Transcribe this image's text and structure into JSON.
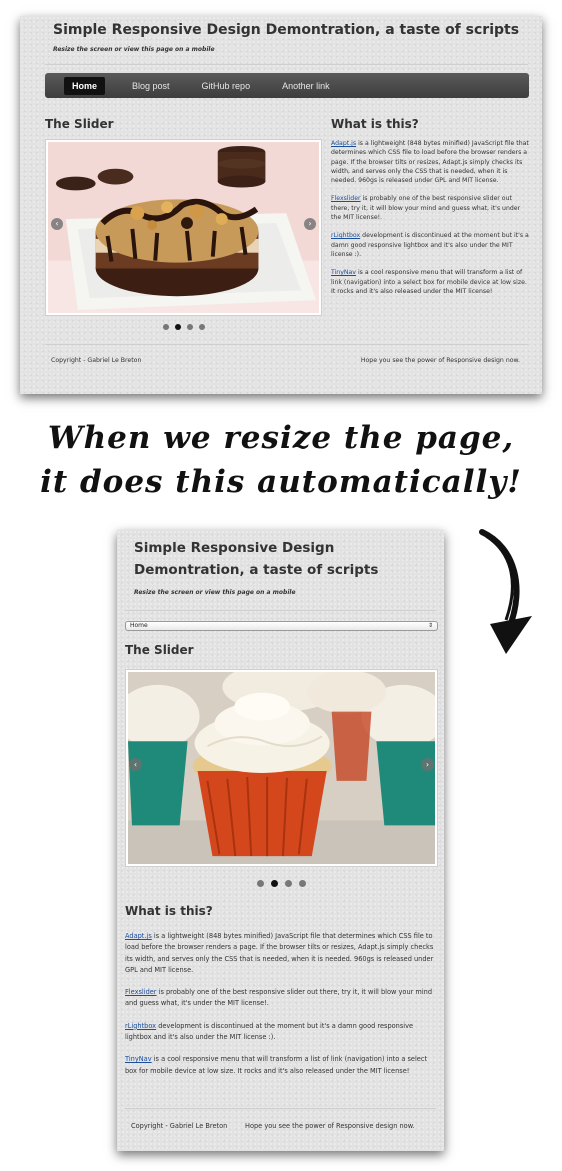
{
  "site": {
    "title": "Simple Responsive Design Demontration, a taste of scripts",
    "subtitle": "Resize the screen or view this page on a mobile"
  },
  "nav": {
    "items": [
      {
        "label": "Home",
        "active": true
      },
      {
        "label": "Blog post",
        "active": false
      },
      {
        "label": "GitHub repo",
        "active": false
      },
      {
        "label": "Another link",
        "active": false
      }
    ],
    "select_value": "Home"
  },
  "slider": {
    "heading": "The Slider",
    "prev_arrow": "‹",
    "next_arrow": "›",
    "dots": 4,
    "active_dot": 1,
    "desktop_image": "chocolate-dessert-photo",
    "mobile_image": "cupcakes-photo"
  },
  "info": {
    "heading": "What is this?",
    "paragraphs": [
      {
        "link": "Adapt.js",
        "text": " is a lightweight (848 bytes minified) JavaScript file that determines which CSS file to load before the browser renders a page. If the browser tilts or resizes, Adapt.js simply checks its width, and serves only the CSS that is needed, when it is needed. 960gs is released under GPL and MIT license."
      },
      {
        "link": "Flexslider",
        "text": " is probably one of the best responsive slider out there, try it, it will blow your mind and guess what, it's under the MIT license!."
      },
      {
        "link": "rLightbox",
        "text": " development is discontinued at the moment but it's a damn good responsive lightbox and it's also under the MIT license :)."
      },
      {
        "link": "TinyNav",
        "text": " is a cool responsive menu that will transform a list of link (navigation) into a select box for mobile device at low size. It rocks and it's also released under the MIT license!"
      }
    ]
  },
  "footer": {
    "copyright": "Copyright - Gabriel Le Breton",
    "tagline": "Hope you see the power of Responsive design now."
  },
  "caption": {
    "line1": "When we resize the page,",
    "line2": "it does this automatically!"
  },
  "colors": {
    "page_background": "#e2e2e2",
    "navbar": "#4a4a4a",
    "nav_active": "#111111",
    "link": "#1a4f9c",
    "text": "#333333"
  }
}
